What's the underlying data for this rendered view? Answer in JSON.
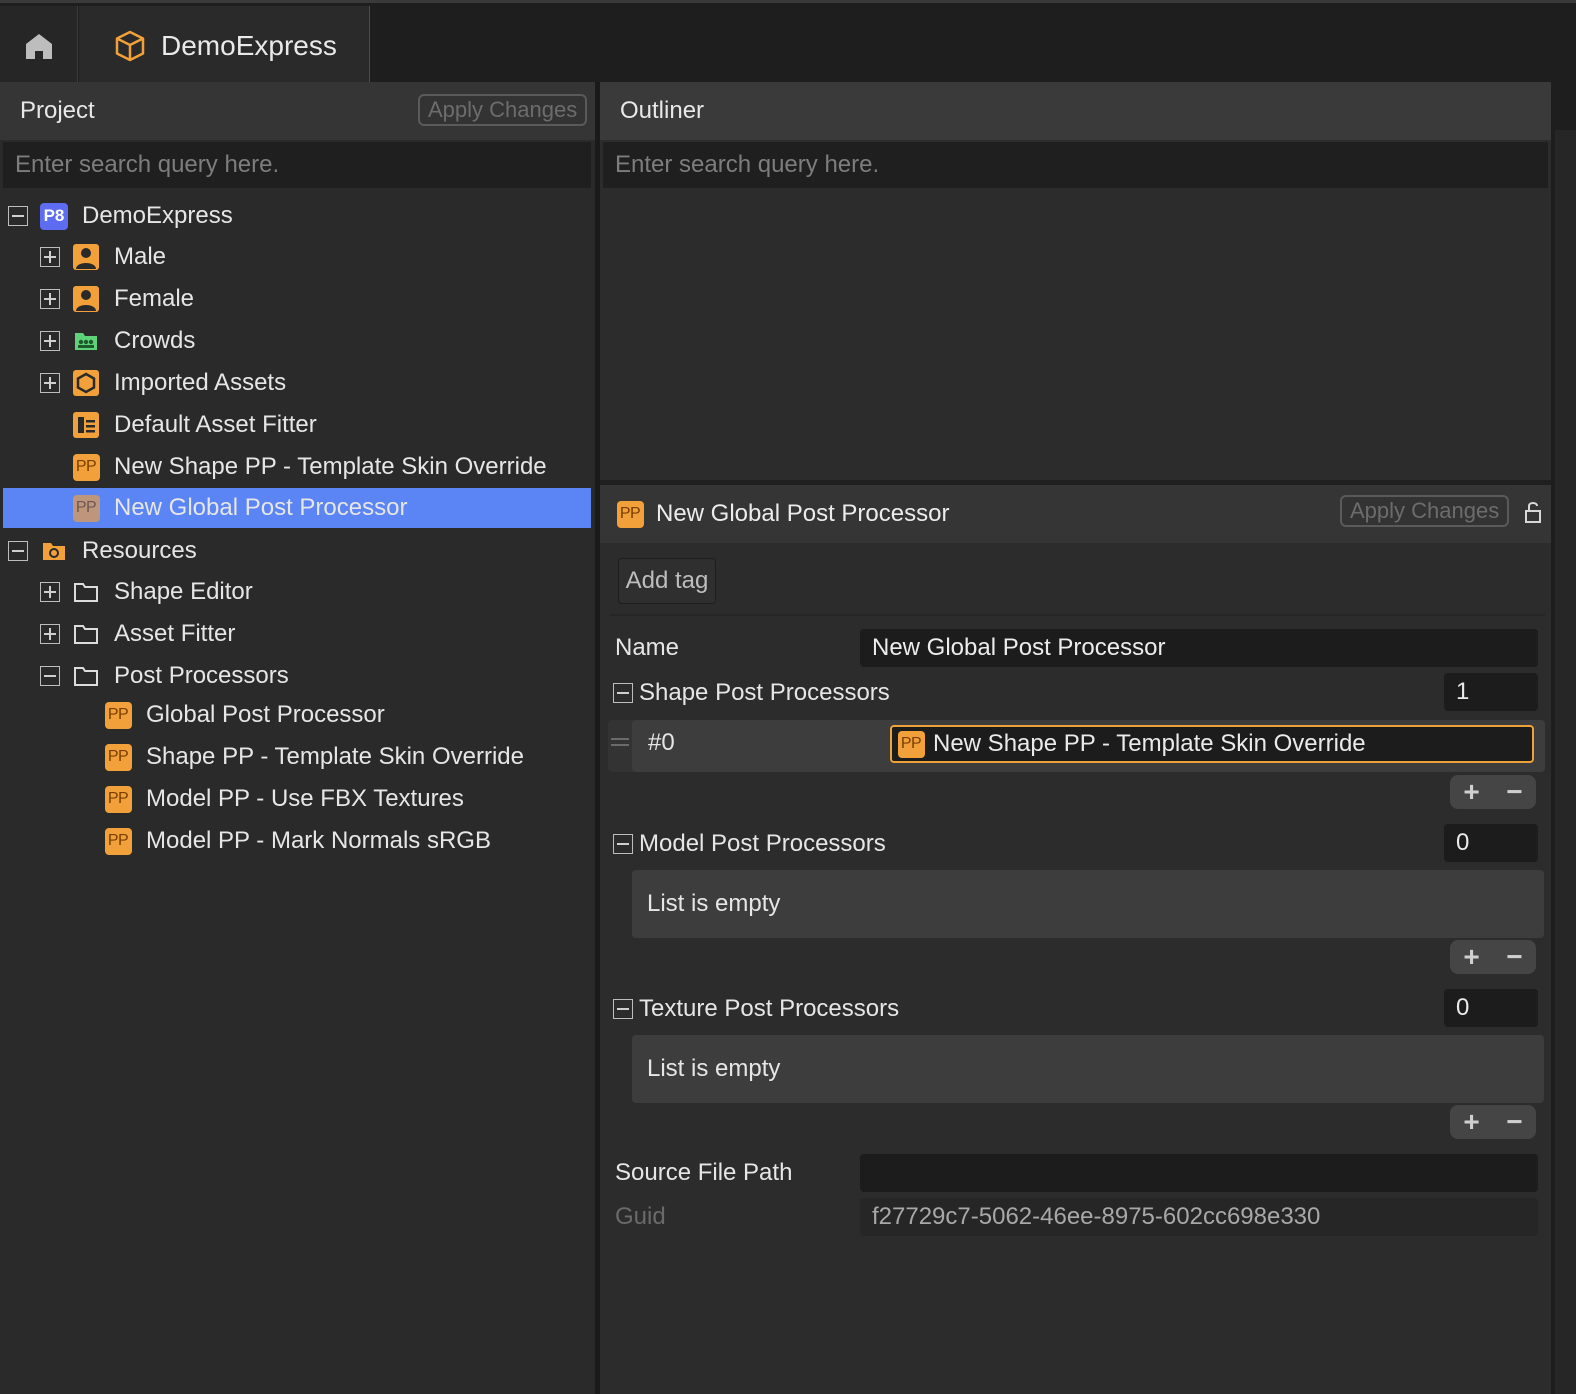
{
  "tabs": {
    "home_icon": "home-icon",
    "document_title": "DemoExpress"
  },
  "project": {
    "title": "Project",
    "apply_label": "Apply Changes",
    "search_placeholder": "Enter search query here.",
    "tree": [
      {
        "label": "DemoExpress",
        "icon": "p8-project-icon",
        "toggle": "minus"
      },
      {
        "label": "Male",
        "icon": "character-icon",
        "toggle": "plus"
      },
      {
        "label": "Female",
        "icon": "character-icon",
        "toggle": "plus"
      },
      {
        "label": "Crowds",
        "icon": "crowd-icon",
        "toggle": "plus"
      },
      {
        "label": "Imported Assets",
        "icon": "hexagon-icon",
        "toggle": "plus"
      },
      {
        "label": "Default Asset Fitter",
        "icon": "fitter-icon"
      },
      {
        "label": "New Shape PP - Template Skin Override",
        "icon": "pp-icon"
      },
      {
        "label": "New Global Post Processor",
        "icon": "pp-icon",
        "selected": true
      },
      {
        "label": "Resources",
        "icon": "resources-folder-icon",
        "toggle": "minus"
      },
      {
        "label": "Shape Editor",
        "icon": "folder-icon",
        "toggle": "plus"
      },
      {
        "label": "Asset Fitter",
        "icon": "folder-icon",
        "toggle": "plus"
      },
      {
        "label": "Post Processors",
        "icon": "folder-icon",
        "toggle": "minus"
      },
      {
        "label": "Global Post Processor",
        "icon": "pp-icon"
      },
      {
        "label": "Shape PP - Template Skin Override",
        "icon": "pp-icon"
      },
      {
        "label": "Model PP - Use FBX Textures",
        "icon": "pp-icon"
      },
      {
        "label": "Model PP - Mark Normals sRGB",
        "icon": "pp-icon"
      }
    ]
  },
  "outliner": {
    "title": "Outliner",
    "search_placeholder": "Enter search query here."
  },
  "inspector": {
    "title": "New Global Post Processor",
    "apply_label": "Apply Changes",
    "add_tag_label": "Add tag",
    "name_label": "Name",
    "name_value": "New Global Post Processor",
    "shape_pp": {
      "label": "Shape Post Processors",
      "count": "1",
      "item_index": "#0",
      "item_value": "New Shape PP - Template Skin Override"
    },
    "model_pp": {
      "label": "Model Post Processors",
      "count": "0",
      "empty_text": "List is empty"
    },
    "texture_pp": {
      "label": "Texture Post Processors",
      "count": "0",
      "empty_text": "List is empty"
    },
    "source_label": "Source File Path",
    "source_value": "",
    "guid_label": "Guid",
    "guid_value": "f27729c7-5062-46ee-8975-602cc698e330",
    "pp_badge": "PP",
    "p8_badge": "P8"
  },
  "colors": {
    "selection": "#5b84f5",
    "accent_orange": "#f2a03a",
    "panel_bg": "#2a2a2a"
  }
}
